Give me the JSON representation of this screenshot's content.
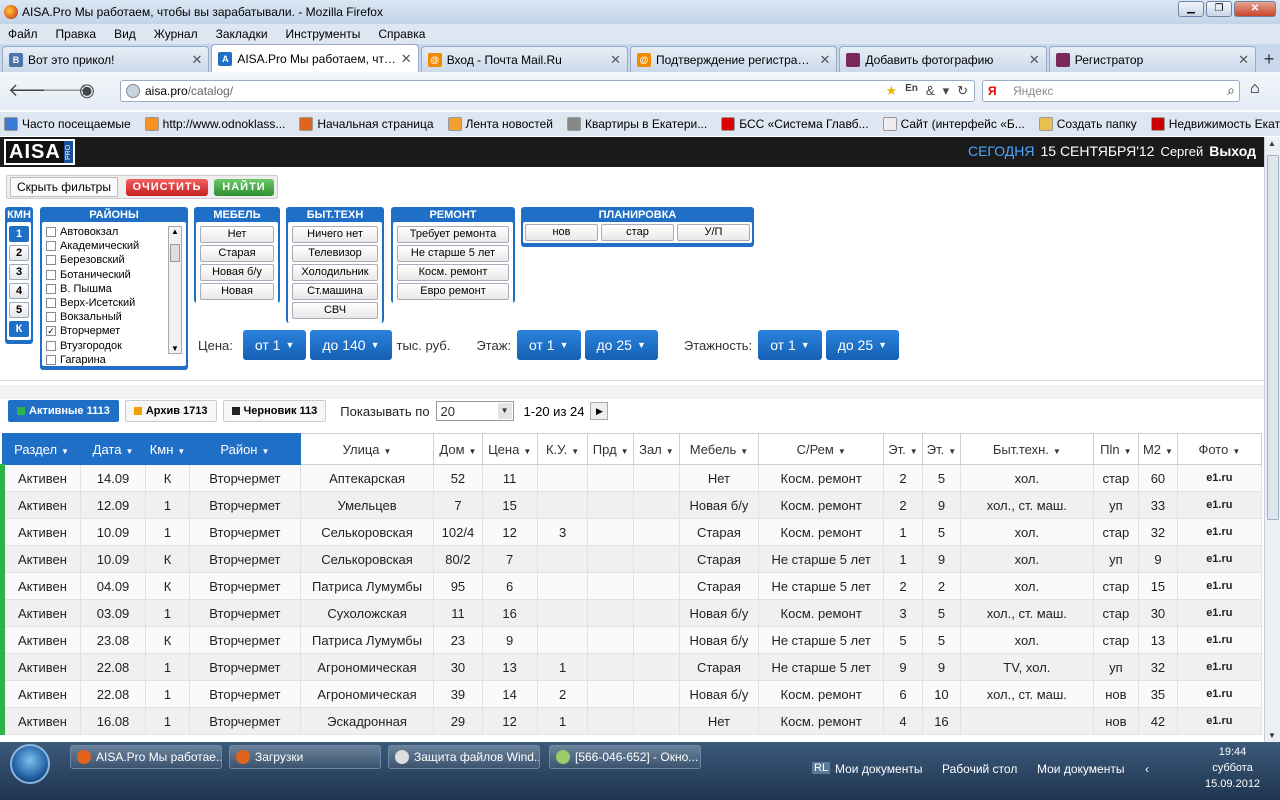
{
  "window": {
    "title": "AISA.Pro Мы работаем, чтобы вы зарабатывали. - Mozilla Firefox"
  },
  "menu": [
    "Файл",
    "Правка",
    "Вид",
    "Журнал",
    "Закладки",
    "Инструменты",
    "Справка"
  ],
  "tabs": [
    {
      "label": "Вот это прикол!",
      "color": "#4a76a8",
      "glyph": "В"
    },
    {
      "label": "AISA.Pro Мы работаем, чтобы ...",
      "color": "#1f6fc6",
      "glyph": "A"
    },
    {
      "label": "Вход - Почта Mail.Ru",
      "color": "#f08a00",
      "glyph": "@"
    },
    {
      "label": "Подтверждение регистрации ...",
      "color": "#f08a00",
      "glyph": "@"
    },
    {
      "label": "Добавить фотографию",
      "color": "#7a2a5a",
      "glyph": ""
    },
    {
      "label": "Регистратор",
      "color": "#7a2a5a",
      "glyph": ""
    }
  ],
  "url": {
    "host": "aisa.pro",
    "path": "/catalog/"
  },
  "search": {
    "placeholder": "Яндекс",
    "engine": "Я"
  },
  "bookmarks": [
    {
      "label": "Часто посещаемые",
      "color": "#3a7bd5"
    },
    {
      "label": "http://www.odnoklass...",
      "color": "#f7931e"
    },
    {
      "label": "Начальная страница",
      "color": "#e0641e"
    },
    {
      "label": "Лента новостей",
      "color": "#f0a030"
    },
    {
      "label": "Квартиры в Екатери...",
      "color": "#888"
    },
    {
      "label": "БСС «Система Главб...",
      "color": "#d00"
    },
    {
      "label": "Сайт (интерфейс «Б...",
      "color": "#eee"
    },
    {
      "label": "Создать папку",
      "color": "#e8c050"
    },
    {
      "label": "Недвижимость Екат...",
      "color": "#c00"
    }
  ],
  "header": {
    "logo": "AISA",
    "logo_sub": "PRO",
    "today": "СЕГОДНЯ",
    "date": "15 СЕНТЯБРЯ'12",
    "user": "Сергей",
    "logout": "Выход"
  },
  "filters": {
    "hide": "Скрыть фильтры",
    "clear": "ОЧИСТИТЬ",
    "find": "НАЙТИ",
    "rooms": {
      "title": "КМН",
      "items": [
        "1",
        "2",
        "3",
        "4",
        "5",
        "К"
      ],
      "selected": [
        "1",
        "К"
      ]
    },
    "districts": {
      "title": "РАЙОНЫ",
      "items": [
        {
          "label": "Автовокзал",
          "checked": false
        },
        {
          "label": "Академический",
          "checked": false
        },
        {
          "label": "Березовский",
          "checked": false
        },
        {
          "label": "Ботанический",
          "checked": false
        },
        {
          "label": "В. Пышма",
          "checked": false
        },
        {
          "label": "Верх-Исетский",
          "checked": false
        },
        {
          "label": "Вокзальный",
          "checked": false
        },
        {
          "label": "Вторчермет",
          "checked": true
        },
        {
          "label": "Втузгородок",
          "checked": false
        },
        {
          "label": "Гагарина",
          "checked": false
        }
      ]
    },
    "furniture": {
      "title": "МЕБЕЛЬ",
      "items": [
        "Нет",
        "Старая",
        "Новая б/у",
        "Новая"
      ]
    },
    "appliances": {
      "title": "БЫТ.ТЕХН",
      "items": [
        "Ничего нет",
        "Телевизор",
        "Холодильник",
        "Ст.машина",
        "СВЧ"
      ]
    },
    "repair": {
      "title": "РЕМОНТ",
      "items": [
        "Требует ремонта",
        "Не старше 5 лет",
        "Косм. ремонт",
        "Евро ремонт"
      ]
    },
    "layout": {
      "title": "ПЛАНИРОВКА",
      "items": [
        "нов",
        "стар",
        "У/П"
      ]
    },
    "price": {
      "label": "Цена:",
      "from": "от 1",
      "to": "до 140",
      "unit": "тыс. руб."
    },
    "floor": {
      "label": "Этаж:",
      "from": "от 1",
      "to": "до 25"
    },
    "floors": {
      "label": "Этажность:",
      "from": "от 1",
      "to": "до 25"
    }
  },
  "status": {
    "active": "Активные 1113",
    "archive": "Архив 1713",
    "draft": "Черновик 113",
    "show_label": "Показывать по",
    "per_page": "20",
    "pager": "1-20 из 24"
  },
  "table": {
    "columns": [
      "Раздел",
      "Дата",
      "Кмн",
      "Район",
      "Улица",
      "Дом",
      "Цена",
      "К.У.",
      "Прд",
      "Зал",
      "Мебель",
      "С/Рем",
      "Эт.",
      "Эт.",
      "Быт.техн.",
      "Пln",
      "М2",
      "Фото"
    ],
    "rows": [
      [
        "Активен",
        "14.09",
        "К",
        "Вторчермет",
        "Аптекарская",
        "52",
        "11",
        "",
        "",
        "",
        "Нет",
        "Косм. ремонт",
        "2",
        "5",
        "хол.",
        "стар",
        "60",
        "e1.ru"
      ],
      [
        "Активен",
        "12.09",
        "1",
        "Вторчермет",
        "Умельцев",
        "7",
        "15",
        "",
        "",
        "",
        "Новая б/у",
        "Косм. ремонт",
        "2",
        "9",
        "хол., ст. маш.",
        "уп",
        "33",
        "e1.ru"
      ],
      [
        "Активен",
        "10.09",
        "1",
        "Вторчермет",
        "Селькоровская",
        "102/4",
        "12",
        "3",
        "",
        "",
        "Старая",
        "Косм. ремонт",
        "1",
        "5",
        "хол.",
        "стар",
        "32",
        "e1.ru"
      ],
      [
        "Активен",
        "10.09",
        "К",
        "Вторчермет",
        "Селькоровская",
        "80/2",
        "7",
        "",
        "",
        "",
        "Старая",
        "Не старше 5 лет",
        "1",
        "9",
        "хол.",
        "уп",
        "9",
        "e1.ru"
      ],
      [
        "Активен",
        "04.09",
        "К",
        "Вторчермет",
        "Патриса Лумумбы",
        "95",
        "6",
        "",
        "",
        "",
        "Старая",
        "Не старше 5 лет",
        "2",
        "2",
        "хол.",
        "стар",
        "15",
        "e1.ru"
      ],
      [
        "Активен",
        "03.09",
        "1",
        "Вторчермет",
        "Сухоложская",
        "11",
        "16",
        "",
        "",
        "",
        "Новая б/у",
        "Косм. ремонт",
        "3",
        "5",
        "хол., ст. маш.",
        "стар",
        "30",
        "e1.ru"
      ],
      [
        "Активен",
        "23.08",
        "К",
        "Вторчермет",
        "Патриса Лумумбы",
        "23",
        "9",
        "",
        "",
        "",
        "Новая б/у",
        "Не старше 5 лет",
        "5",
        "5",
        "хол.",
        "стар",
        "13",
        "e1.ru"
      ],
      [
        "Активен",
        "22.08",
        "1",
        "Вторчермет",
        "Агрономическая",
        "30",
        "13",
        "1",
        "",
        "",
        "Старая",
        "Не старше 5 лет",
        "9",
        "9",
        "TV, хол.",
        "уп",
        "32",
        "e1.ru"
      ],
      [
        "Активен",
        "22.08",
        "1",
        "Вторчермет",
        "Агрономическая",
        "39",
        "14",
        "2",
        "",
        "",
        "Новая б/у",
        "Косм. ремонт",
        "6",
        "10",
        "хол., ст. маш.",
        "нов",
        "35",
        "e1.ru"
      ],
      [
        "Активен",
        "16.08",
        "1",
        "Вторчермет",
        "Эскадронная",
        "29",
        "12",
        "1",
        "",
        "",
        "Нет",
        "Косм. ремонт",
        "4",
        "16",
        "",
        "нов",
        "42",
        "e1.ru"
      ]
    ]
  },
  "taskbar": {
    "buttons": [
      {
        "label": "AISA.Pro Мы работае...",
        "color": "#e0641e"
      },
      {
        "label": "Загрузки",
        "color": "#e0641e"
      },
      {
        "label": "Защита файлов Wind...",
        "color": "#ddd"
      },
      {
        "label": "[566-046-652] - Окно...",
        "color": "#9c6"
      }
    ],
    "tray": [
      "Мои документы",
      "Рабочий стол",
      "Мои документы"
    ],
    "lang": "RL",
    "time": "19:44",
    "day": "суббота",
    "date": "15.09.2012"
  }
}
